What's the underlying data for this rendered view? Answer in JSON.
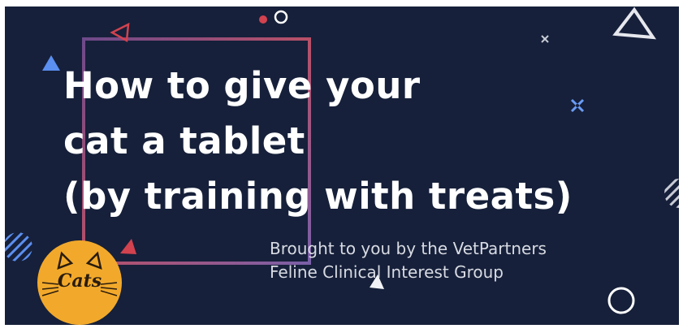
{
  "slide": {
    "title_lines": [
      "How to give your",
      "cat a tablet",
      "(by training with treats)"
    ],
    "subtitle_lines": [
      "Brought to you by the VetPartners",
      "Feline Clinical Interest Group"
    ],
    "logo_text": "Cats"
  },
  "colors": {
    "background": "#16203a",
    "badge": "#f2a92b",
    "accent_red": "#d2424f",
    "accent_blue": "#5b8ff0",
    "text": "#ffffff"
  },
  "icons": [
    "triangle-outline-icon",
    "circle-outline-icon",
    "cross-icon",
    "striped-circle-icon",
    "cat-ears-icon"
  ]
}
